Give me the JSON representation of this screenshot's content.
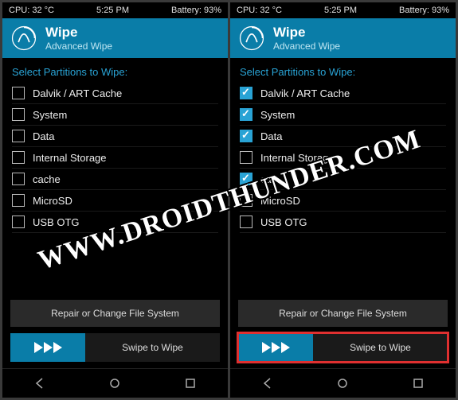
{
  "watermark": "WWW.DROIDTHUNDER.COM",
  "status": {
    "cpu": "CPU: 32 °C",
    "time": "5:25 PM",
    "battery": "Battery: 93%"
  },
  "header": {
    "title": "Wipe",
    "subtitle": "Advanced Wipe"
  },
  "section_title": "Select Partitions to Wipe:",
  "partitions": [
    {
      "label": "Dalvik / ART Cache"
    },
    {
      "label": "System"
    },
    {
      "label": "Data"
    },
    {
      "label": "Internal Storage"
    },
    {
      "label": "cache"
    },
    {
      "label": "MicroSD"
    },
    {
      "label": "USB OTG"
    }
  ],
  "screens": [
    {
      "checked": [
        false,
        false,
        false,
        false,
        false,
        false,
        false
      ],
      "highlight_swipe": false
    },
    {
      "checked": [
        true,
        true,
        true,
        false,
        true,
        false,
        false
      ],
      "highlight_swipe": true
    }
  ],
  "repair_label": "Repair or Change File System",
  "swipe_label": "Swipe to Wipe",
  "colors": {
    "accent": "#0a7da8",
    "accent_light": "#29a3d5",
    "highlight": "#e03030"
  }
}
